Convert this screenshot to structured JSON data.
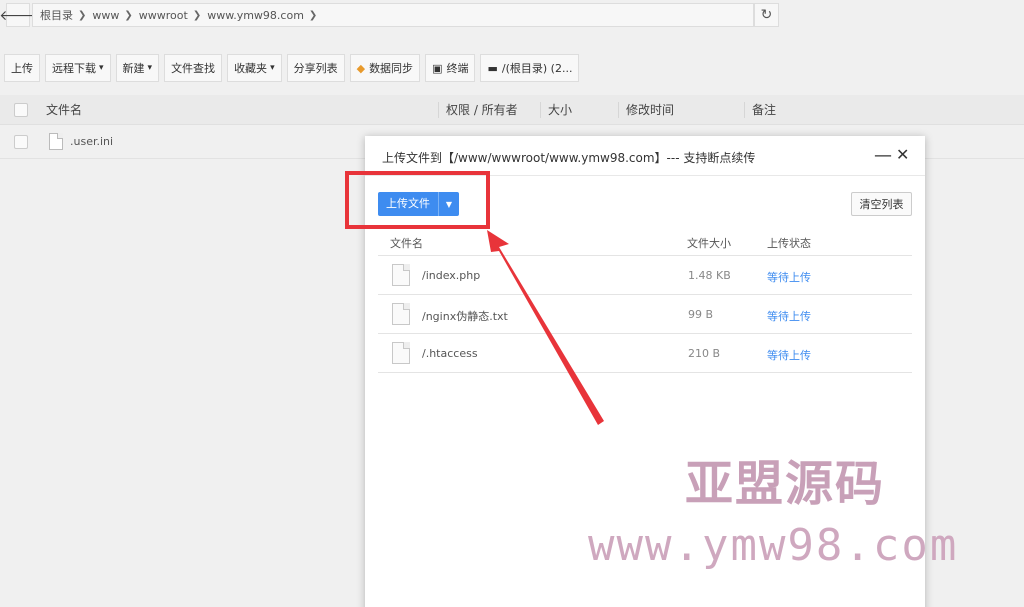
{
  "address_bar": {
    "back_icon": "arrow-left-icon",
    "crumbs": [
      "根目录",
      "www",
      "wwwroot",
      "www.ymw98.com"
    ],
    "refresh_icon": "refresh-icon"
  },
  "toolbar": {
    "upload": "上传",
    "remote_download": "远程下载",
    "new": "新建",
    "file_search": "文件查找",
    "favorites": "收藏夹",
    "share_list": "分享列表",
    "data_sync": "数据同步",
    "terminal": "终端",
    "root_disk": "/(根目录) (2..."
  },
  "file_table": {
    "headers": {
      "name": "文件名",
      "permission_owner": "权限 / 所有者",
      "size": "大小",
      "modified": "修改时间",
      "note": "备注"
    },
    "rows": [
      {
        "name": ".user.ini"
      }
    ]
  },
  "upload_dialog": {
    "title": "上传文件到【/www/wwwroot/www.ymw98.com】--- 支持断点续传",
    "upload_button": "上传文件",
    "clear_button": "清空列表",
    "headers": {
      "name": "文件名",
      "size": "文件大小",
      "status": "上传状态"
    },
    "status_color": "#3e8cf0",
    "files": [
      {
        "name": "/index.php",
        "size": "1.48 KB",
        "status": "等待上传"
      },
      {
        "name": "/nginx伪静态.txt",
        "size": "99 B",
        "status": "等待上传"
      },
      {
        "name": "/.htaccess",
        "size": "210 B",
        "status": "等待上传"
      }
    ]
  },
  "watermark": {
    "line1": "亚盟源码",
    "line2": "www.ymw98.com"
  },
  "colors": {
    "accent": "#3e8cf0",
    "annotation": "#e8343a"
  }
}
